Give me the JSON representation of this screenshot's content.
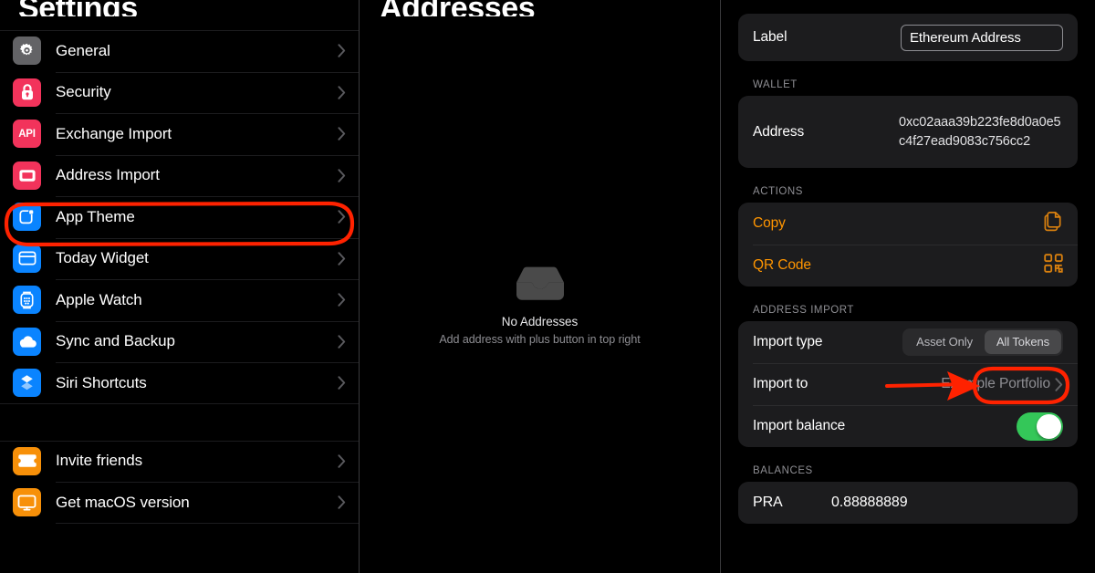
{
  "sidebar": {
    "title": "Settings",
    "groups": [
      {
        "items": [
          {
            "label": "General",
            "icon": "gear-icon",
            "color": "#636366"
          },
          {
            "label": "Security",
            "icon": "lock-icon",
            "color": "#f2335b"
          },
          {
            "label": "Exchange Import",
            "icon": "api-icon",
            "color": "#f2335b",
            "glyph": "API"
          },
          {
            "label": "Address Import",
            "icon": "tray-icon",
            "color": "#f2335b",
            "highlighted": true
          },
          {
            "label": "App Theme",
            "icon": "app-theme-icon",
            "color": "#0a84ff"
          },
          {
            "label": "Today Widget",
            "icon": "widget-icon",
            "color": "#0a84ff"
          },
          {
            "label": "Apple Watch",
            "icon": "apple-watch-icon",
            "color": "#0a84ff"
          },
          {
            "label": "Sync and Backup",
            "icon": "cloud-icon",
            "color": "#0a84ff"
          },
          {
            "label": "Siri Shortcuts",
            "icon": "shortcuts-icon",
            "color": "#0a84ff"
          }
        ]
      },
      {
        "items": [
          {
            "label": "Invite friends",
            "icon": "ticket-icon",
            "color": "#f79009"
          },
          {
            "label": "Get macOS version",
            "icon": "imac-icon",
            "color": "#f79009"
          }
        ]
      }
    ]
  },
  "middle": {
    "title": "Addresses",
    "empty_icon": "tray-empty-icon",
    "empty_title": "No Addresses",
    "empty_subtitle": "Add address with plus button in top right"
  },
  "detail": {
    "label_row": {
      "label": "Label",
      "input_value": "Ethereum Address",
      "input_placeholder": "Label"
    },
    "wallet": {
      "header": "WALLET",
      "address_label": "Address",
      "address_value": "0xc02aaa39b223fe8d0a0e5c4f27ead9083c756cc2"
    },
    "actions": {
      "header": "ACTIONS",
      "items": [
        {
          "label": "Copy",
          "icon": "copy-icon"
        },
        {
          "label": "QR Code",
          "icon": "qr-code-icon"
        }
      ]
    },
    "address_import": {
      "header": "ADDRESS IMPORT",
      "import_type_label": "Import type",
      "import_type_options": [
        "Asset Only",
        "All Tokens"
      ],
      "import_type_selected": "All Tokens",
      "import_to_label": "Import to",
      "import_to_value": "Example Portfolio",
      "import_balance_label": "Import balance",
      "import_balance_on": true
    },
    "balances": {
      "header": "BALANCES",
      "rows": [
        {
          "symbol": "PRA",
          "amount": "0.88888889"
        }
      ]
    }
  },
  "annotations": {
    "color": "#ff2200",
    "items": [
      {
        "name": "highlight-address-import-row",
        "shape": "ellipse"
      },
      {
        "name": "highlight-all-tokens-segment",
        "shape": "ellipse"
      },
      {
        "name": "strike-through-asset-only",
        "shape": "arrow"
      }
    ]
  },
  "theme": {
    "accent": "#ff9500",
    "toggle_on": "#34c759",
    "card_bg": "#1c1c1e",
    "page_bg": "#000000"
  }
}
